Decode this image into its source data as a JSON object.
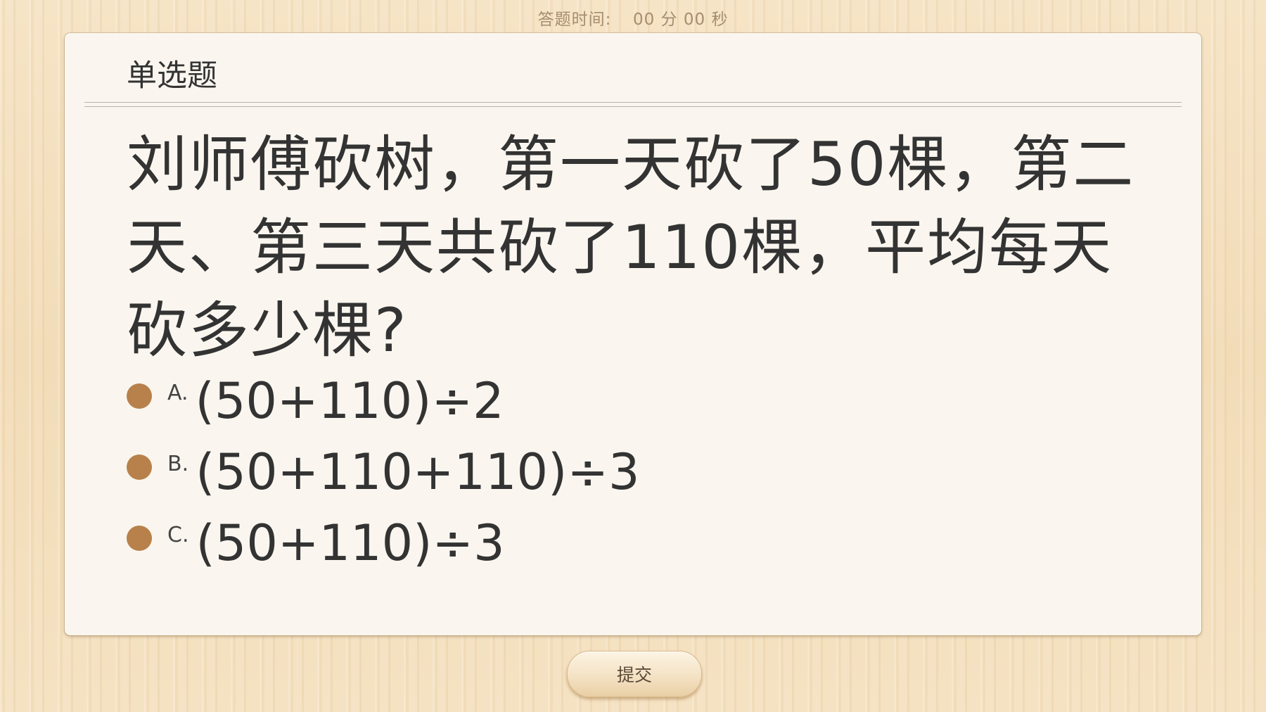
{
  "timer": {
    "label": "答题时间:",
    "minutes": "00",
    "minutes_unit": "分",
    "seconds": "00",
    "seconds_unit": "秒"
  },
  "question": {
    "type": "单选题",
    "text": "刘师傅砍树，第一天砍了50棵，第二天、第三天共砍了110棵，平均每天砍多少棵?",
    "options": [
      {
        "letter": "A.",
        "text": "(50+110)÷2"
      },
      {
        "letter": "B.",
        "text": "(50+110+110)÷3"
      },
      {
        "letter": "C.",
        "text": "(50+110)÷3"
      }
    ]
  },
  "actions": {
    "submit_label": "提交"
  },
  "colors": {
    "radio": "#b8814b",
    "card_bg": "#faf6ef",
    "text": "#333333"
  }
}
